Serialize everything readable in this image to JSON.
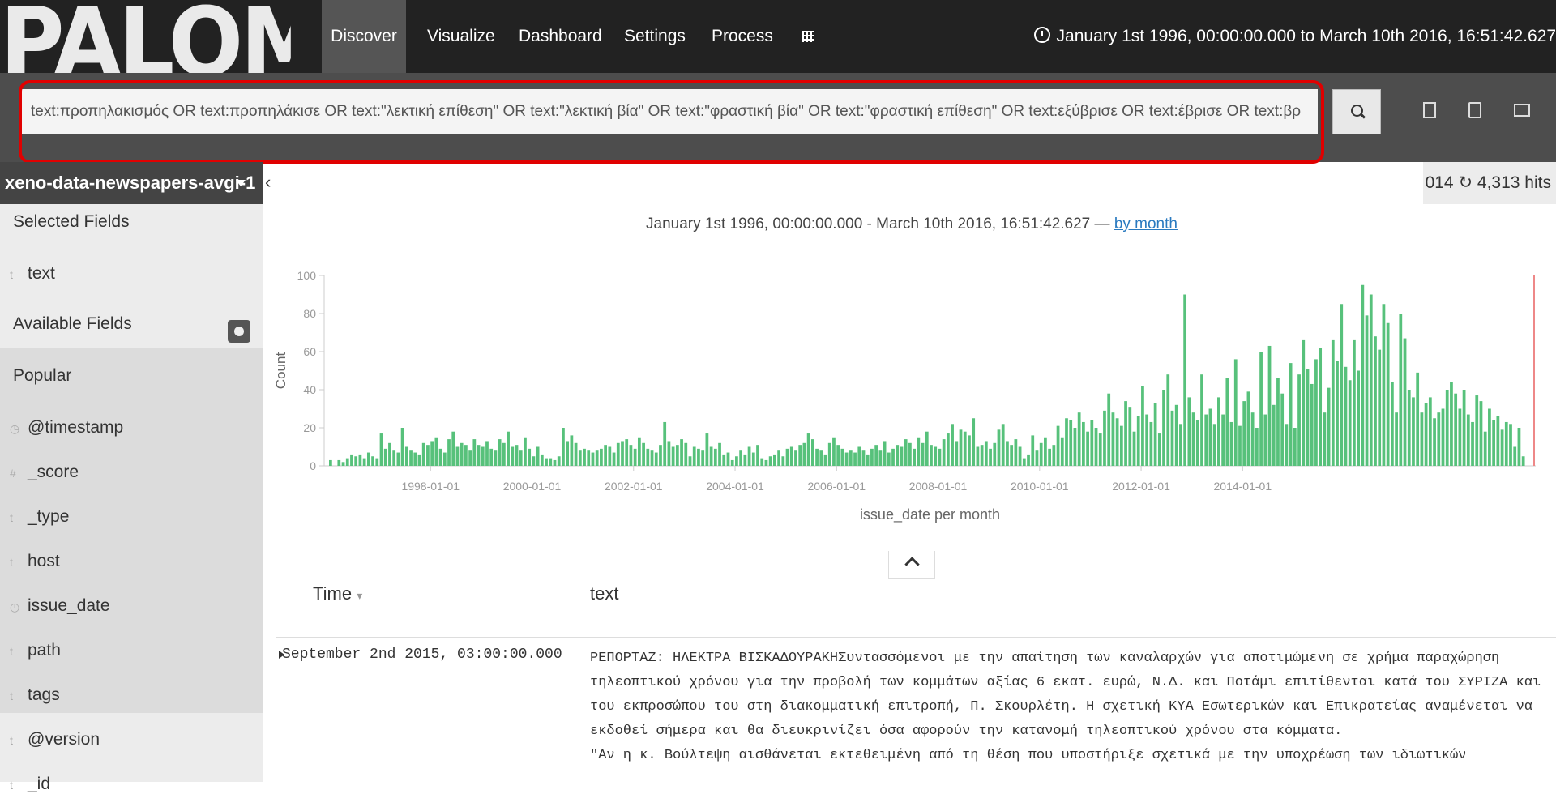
{
  "navbar": {
    "logo": "PALOMAR",
    "tabs": [
      "Discover",
      "Visualize",
      "Dashboard",
      "Settings",
      "Process"
    ],
    "time_range": "January 1st 1996, 00:00:00.000 to March 10th 2016, 16:51:42.627"
  },
  "search": {
    "query": "text:προπηλακισμός OR text:προπηλάκισε OR text:\"λεκτική επίθεση\" OR text:\"λεκτική βία\" OR text:\"φραστική βία\" OR text:\"φραστική επίθεση\" OR text:εξύβρισε OR text:έβρισε OR text:βρ"
  },
  "sidebar": {
    "index": "xeno-data-newspapers-avgi-1",
    "selected_heading": "Selected Fields",
    "selected_fields": [
      {
        "type": "t",
        "name": "text"
      }
    ],
    "available_heading": "Available Fields",
    "popular_heading": "Popular",
    "popular_fields": [
      {
        "type": "◷",
        "name": "@timestamp"
      },
      {
        "type": "#",
        "name": "_score"
      },
      {
        "type": "t",
        "name": "_type"
      },
      {
        "type": "t",
        "name": "host"
      },
      {
        "type": "◷",
        "name": "issue_date"
      },
      {
        "type": "t",
        "name": "path"
      },
      {
        "type": "t",
        "name": "tags"
      },
      {
        "type": "t",
        "name": "@version"
      },
      {
        "type": "t",
        "name": "_id"
      }
    ]
  },
  "hits": {
    "refresh": "014",
    "count": "4,313 hits"
  },
  "chart_header": {
    "range": "January 1st 1996, 00:00:00.000 - March 10th 2016, 16:51:42.627 —",
    "interval_link": "by month"
  },
  "chart_data": {
    "type": "bar",
    "xlabel": "issue_date per month",
    "ylabel": "Count",
    "ylim": [
      0,
      100
    ],
    "yticks": [
      0,
      20,
      40,
      60,
      80,
      100
    ],
    "x_tick_labels": [
      "1998-01-01",
      "2000-01-01",
      "2002-01-01",
      "2004-01-01",
      "2006-01-01",
      "2008-01-01",
      "2010-01-01",
      "2012-01-01",
      "2014-01-01"
    ],
    "color": "#57c17b",
    "start_month": "1996-01",
    "values": [
      3,
      0,
      3,
      2,
      4,
      6,
      5,
      6,
      4,
      7,
      5,
      4,
      17,
      9,
      12,
      8,
      7,
      20,
      10,
      8,
      7,
      6,
      12,
      11,
      13,
      15,
      9,
      7,
      14,
      18,
      10,
      12,
      11,
      8,
      14,
      11,
      10,
      13,
      9,
      8,
      14,
      12,
      18,
      10,
      11,
      8,
      15,
      9,
      5,
      10,
      6,
      4,
      4,
      3,
      5,
      20,
      13,
      16,
      12,
      8,
      9,
      8,
      7,
      8,
      9,
      11,
      10,
      7,
      12,
      13,
      14,
      11,
      9,
      15,
      12,
      9,
      8,
      7,
      11,
      23,
      13,
      10,
      11,
      14,
      12,
      5,
      10,
      9,
      8,
      17,
      10,
      9,
      12,
      6,
      7,
      3,
      5,
      8,
      6,
      10,
      7,
      11,
      4,
      3,
      5,
      6,
      8,
      5,
      9,
      10,
      8,
      11,
      12,
      17,
      14,
      9,
      8,
      6,
      12,
      15,
      11,
      9,
      7,
      8,
      7,
      10,
      8,
      6,
      9,
      11,
      8,
      13,
      7,
      9,
      11,
      10,
      14,
      12,
      9,
      15,
      12,
      18,
      11,
      10,
      9,
      14,
      17,
      22,
      13,
      19,
      18,
      16,
      25,
      10,
      11,
      13,
      9,
      12,
      19,
      22,
      13,
      11,
      14,
      10,
      4,
      6,
      16,
      8,
      12,
      15,
      9,
      11,
      21,
      15,
      25,
      24,
      20,
      28,
      23,
      18,
      24,
      20,
      17,
      29,
      38,
      28,
      25,
      21,
      34,
      31,
      18,
      26,
      42,
      27,
      23,
      33,
      17,
      40,
      48,
      29,
      32,
      22,
      90,
      36,
      28,
      24,
      48,
      27,
      30,
      22,
      36,
      27,
      46,
      23,
      56,
      21,
      34,
      39,
      28,
      20,
      60,
      27,
      63,
      32,
      46,
      38,
      22,
      54,
      20,
      48,
      66,
      51,
      43,
      56,
      62,
      28,
      41,
      66,
      55,
      85,
      52,
      45,
      66,
      50,
      95,
      79,
      90,
      68,
      61,
      85,
      75,
      44,
      28,
      80,
      67,
      40,
      36,
      49,
      28,
      33,
      36,
      25,
      28,
      30,
      40,
      44,
      38,
      30,
      40,
      27,
      23,
      37,
      34,
      18,
      30,
      24,
      26,
      19,
      23,
      22,
      10,
      20,
      5
    ]
  },
  "table": {
    "col_time": "Time",
    "col_text": "text",
    "rows": [
      {
        "time": "September 2nd 2015, 03:00:00.000",
        "lines": [
          "ΡΕΠΟΡΤΑΖ: ΗΛΕΚΤΡΑ ΒΙΣΚΑΔΟΥΡΑΚΗΣυντασσόμενοι με την απαίτηση των καναλαρχών για αποτιμώμενη σε χρήμα παραχώρηση",
          "τηλεοπτικού χρόνου για την προβολή των κομμάτων αξίας 6 εκατ. ευρώ, Ν.Δ. και Ποτάμι επιτίθενται κατά του ΣΥΡΙΖΑ και",
          "του εκπροσώπου του στη διακομματική επιτροπή, Π. Σκουρλέτη. Η σχετική ΚΥΑ Εσωτερικών και Επικρατείας αναμένεται να",
          "εκδοθεί σήμερα και θα διευκρινίζει όσα αφορούν την κατανομή τηλεοπτικού χρόνου στα κόμματα.",
          "\"Αν η κ. Βούλτεψη αισθάνεται εκτεθειμένη από τη θέση που υποστήριξε σχετικά με την υποχρέωση των ιδιωτικών"
        ]
      }
    ]
  }
}
